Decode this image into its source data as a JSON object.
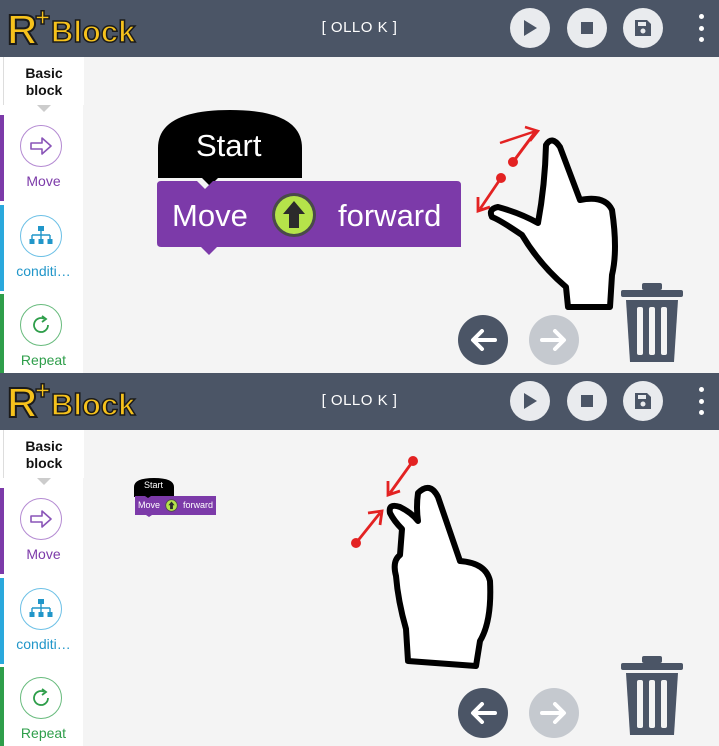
{
  "app": {
    "logo_text": "R+Block",
    "device_label": "[ OLLO K ]",
    "toolbar": {
      "play_icon": "play-icon",
      "stop_icon": "stop-icon",
      "save_icon": "save-icon",
      "menu_icon": "more-vertical-icon"
    }
  },
  "sidebar": {
    "basic_block": [
      "Basic",
      "block"
    ],
    "categories": [
      {
        "label": "Move",
        "icon": "arrow-right-icon",
        "color": "#7c3aa9"
      },
      {
        "label": "conditi…",
        "icon": "flowchart-icon",
        "color": "#2196c9"
      },
      {
        "label": "Repeat",
        "icon": "repeat-icon",
        "color": "#2e9e4a"
      }
    ]
  },
  "blocks": {
    "start_label": "Start",
    "move_label": "Move",
    "direction_icon": "arrow-up-icon",
    "direction_label": "forward"
  },
  "workspace": {
    "undo_icon": "arrow-left-icon",
    "redo_icon": "arrow-right-icon",
    "trash_icon": "trash-icon"
  },
  "panels": {
    "top_gesture": "pinch-out-icon",
    "bottom_gesture": "pinch-in-icon"
  },
  "colors": {
    "topbar": "#4b5566",
    "move_block": "#7c3aa9",
    "start_block": "#000000",
    "direction_badge": "#b5e34a",
    "accent_red": "#e32222"
  }
}
